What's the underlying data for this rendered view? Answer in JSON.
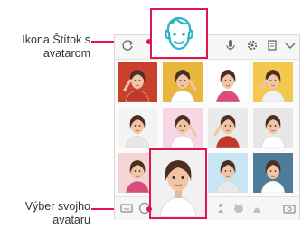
{
  "callouts": {
    "sticker_tab_label": "Ikona Štítok s avatarom",
    "avatar_select_label": "Výber svojho avataru"
  },
  "colors": {
    "accent": "#e0174f",
    "icon_teal": "#2bb5c6"
  },
  "toolbar": {
    "icons": [
      "refresh-icon",
      "avatar-sticker-icon",
      "microphone-icon",
      "settings-icon",
      "clipboard-icon",
      "chevron-down-icon"
    ]
  },
  "bottom_bar": {
    "icons": [
      "keyboard-icon",
      "emoji-icon",
      "gif-icon",
      "sticker-icon",
      "avatar-icon",
      "camera-icon"
    ]
  },
  "stickers": {
    "backgrounds": [
      "#c9412c",
      "#e7b63a",
      "#ffffff",
      "#f2c94c",
      "#f4f4f4",
      "#f7d7e6",
      "#eaeaea",
      "#e7e7e7",
      "#f4d6d6",
      "#bfe0ee",
      "#c6e6f4",
      "#4d7b9a"
    ]
  }
}
